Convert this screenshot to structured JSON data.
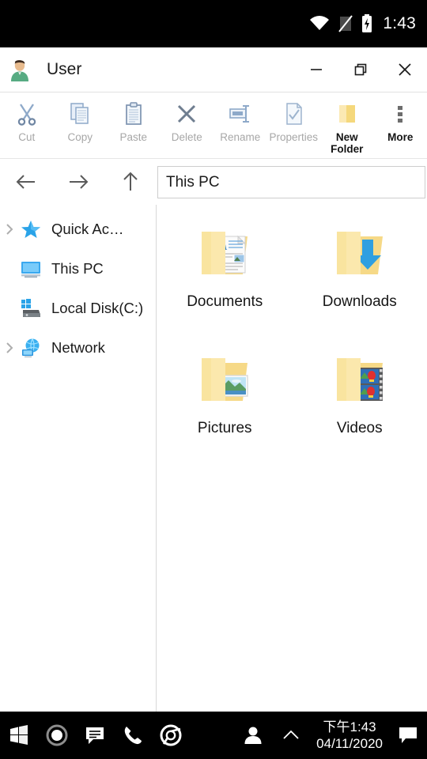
{
  "status_bar": {
    "wifi_icon": "wifi-icon",
    "signal_icon": "no-sim-signal-icon",
    "battery_icon": "battery-charging-icon",
    "time": "1:43"
  },
  "window": {
    "avatar_icon": "user-avatar-icon",
    "title": "User",
    "minimize_label": "minimize-icon",
    "restore_label": "restore-icon",
    "close_label": "close-icon"
  },
  "toolbar": {
    "items": [
      {
        "label": "Cut",
        "icon": "scissors-icon",
        "enabled": false
      },
      {
        "label": "Copy",
        "icon": "copy-pages-icon",
        "enabled": false
      },
      {
        "label": "Paste",
        "icon": "clipboard-icon",
        "enabled": false
      },
      {
        "label": "Delete",
        "icon": "x-cross-icon",
        "enabled": false
      },
      {
        "label": "Rename",
        "icon": "rename-label-icon",
        "enabled": false
      },
      {
        "label": "Properties",
        "icon": "document-check-icon",
        "enabled": false
      },
      {
        "label": "New Folder",
        "icon": "folder-icon",
        "enabled": true
      },
      {
        "label": "More",
        "icon": "overflow-dots-icon",
        "enabled": true
      }
    ]
  },
  "navigation": {
    "back_icon": "arrow-left-icon",
    "forward_icon": "arrow-right-icon",
    "up_icon": "arrow-up-icon",
    "address_value": "This PC"
  },
  "sidebar": {
    "items": [
      {
        "label": "Quick Ac…",
        "icon": "star-icon",
        "has_chevron": true
      },
      {
        "label": "This PC",
        "icon": "monitor-icon",
        "has_chevron": false
      },
      {
        "label": "Local Disk(C:)",
        "icon": "hard-drive-icon",
        "has_chevron": false
      },
      {
        "label": "Network",
        "icon": "network-globe-icon",
        "has_chevron": true
      }
    ]
  },
  "content": {
    "tiles": [
      {
        "label": "Documents",
        "icon": "folder-documents-icon"
      },
      {
        "label": "Downloads",
        "icon": "folder-downloads-icon"
      },
      {
        "label": "Pictures",
        "icon": "folder-pictures-icon"
      },
      {
        "label": "Videos",
        "icon": "folder-videos-icon"
      }
    ]
  },
  "taskbar": {
    "start_icon": "windows-start-icon",
    "cortana_icon": "cortana-circle-icon",
    "messages_icon": "messages-bubble-icon",
    "phone_icon": "phone-handset-icon",
    "chrome_icon": "chrome-icon",
    "people_icon": "person-icon",
    "chevron_icon": "chevron-up-icon",
    "clock_time": "下午1:43",
    "clock_date": "04/11/2020",
    "notification_icon": "notification-bubble-icon"
  },
  "colors": {
    "folder_yellow": "#f5d97f",
    "accent_blue": "#2aa3e8",
    "disabled_gray": "#a7a7a7",
    "ribbon_icon_blue": "#8ea9c9"
  }
}
